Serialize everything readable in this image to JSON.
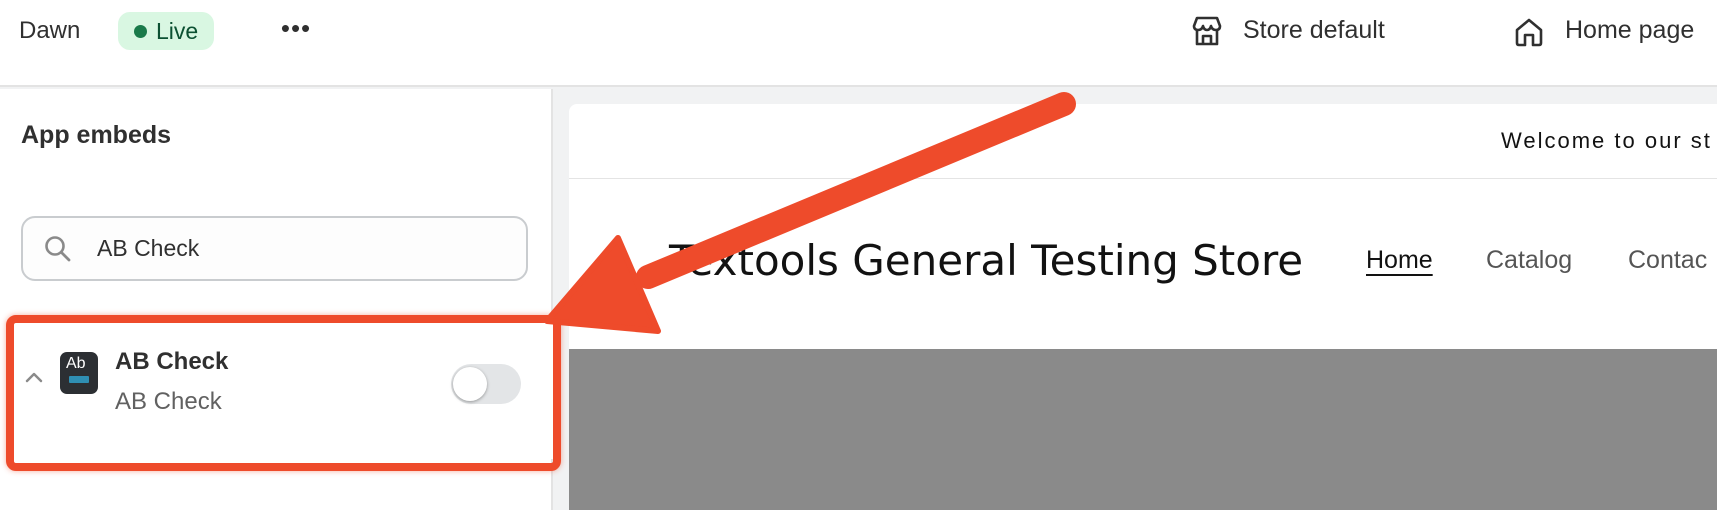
{
  "topbar": {
    "theme_name": "Dawn",
    "status_badge": "Live",
    "more_label": "•••",
    "store_selector": "Store default",
    "page_selector": "Home page"
  },
  "sidebar": {
    "title": "App embeds",
    "search": {
      "value": "AB Check",
      "placeholder": ""
    },
    "embed": {
      "icon_text": "Ab",
      "title": "AB Check",
      "subtitle": "AB Check",
      "enabled": false
    }
  },
  "preview": {
    "announcement": "Welcome to our st",
    "store_name": "Textools General Testing Store",
    "nav": {
      "home": "Home",
      "catalog": "Catalog",
      "contact": "Contac"
    }
  },
  "colors": {
    "annotation": "#ee4b2b",
    "live_badge_bg": "#d9f7e2",
    "live_dot": "#1a7a4a",
    "banner": "#8a8a8a"
  },
  "icons": [
    "chevron-up-icon",
    "search-icon",
    "store-icon",
    "home-icon",
    "ellipsis-icon",
    "app-icon"
  ]
}
